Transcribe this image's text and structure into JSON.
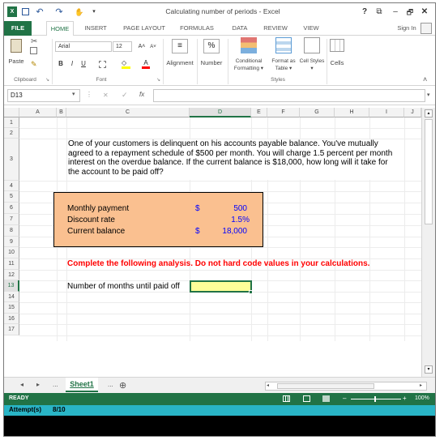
{
  "window": {
    "title": "Calculating number of periods - Excel",
    "controls": {
      "help": "?",
      "restore_ribbon": "⧉",
      "minimize": "–",
      "maximize": "🗗",
      "close": "✕"
    }
  },
  "qat": {
    "save": "▪",
    "undo": "↶",
    "redo": "↷",
    "touch": "✋",
    "more": "▾"
  },
  "tabs": [
    {
      "label": "FILE"
    },
    {
      "label": "HOME"
    },
    {
      "label": "INSERT"
    },
    {
      "label": "PAGE LAYOUT"
    },
    {
      "label": "FORMULAS"
    },
    {
      "label": "DATA"
    },
    {
      "label": "REVIEW"
    },
    {
      "label": "VIEW"
    }
  ],
  "sign_in": "Sign In",
  "ribbon": {
    "paste": "Paste",
    "font_name": "Arial",
    "font_size": "12",
    "grow": "A˄",
    "shrink": "A˅",
    "bold": "B",
    "italic": "I",
    "underline": "U",
    "alignment": "Alignment",
    "number": "Number",
    "percent": "%",
    "conditional": "Conditional Formatting ▾",
    "format_table": "Format as Table ▾",
    "cell_styles": "Cell Styles ▾",
    "cells": "Cells",
    "groups": {
      "clipboard": "Clipboard",
      "font": "Font",
      "styles": "Styles"
    },
    "collapse": "˄"
  },
  "formula_bar": {
    "name_box": "D13",
    "cancel": "✕",
    "enter": "✓",
    "fx": "fx",
    "value": ""
  },
  "columns": [
    "A",
    "B",
    "C",
    "D",
    "E",
    "F",
    "G",
    "H",
    "I",
    "J"
  ],
  "rows": [
    "1",
    "2",
    "3",
    "4",
    "5",
    "6",
    "7",
    "8",
    "9",
    "10",
    "11",
    "12",
    "13",
    "14",
    "15",
    "16",
    "17"
  ],
  "content": {
    "problem": "One of your customers is delinquent on his accounts payable balance. You've mutually agreed to a repayment schedule of $500 per month. You will charge 1.5 percent per month interest on the overdue balance. If the current balance is $18,000, how long will it take for the account to be paid off?",
    "inputs": [
      {
        "label": "Monthly payment",
        "symbol": "$",
        "value": "500"
      },
      {
        "label": "Discount rate",
        "symbol": "",
        "value": "1.5%"
      },
      {
        "label": "Current balance",
        "symbol": "$",
        "value": "18,000"
      }
    ],
    "instruction": "Complete the following analysis. Do not hard code values in your calculations.",
    "question_label": "Number of months until paid off",
    "answer_value": ""
  },
  "sheet_tabs": {
    "prev": "◂",
    "next": "▸",
    "ellipsis": "...",
    "active": "Sheet1",
    "more": "...",
    "add": "⊕"
  },
  "status": {
    "ready": "READY",
    "zoom": "100%",
    "zoom_minus": "–",
    "zoom_plus": "+"
  },
  "attempt": {
    "label": "Attempt(s)",
    "value": "8/10"
  },
  "colors": {
    "excel_green": "#217346",
    "input_box_fill": "#fac090",
    "answer_fill": "#ffff99",
    "instruction_red": "#ff0000",
    "value_blue": "#0000ff",
    "attempt_bar": "#29b5c6"
  }
}
